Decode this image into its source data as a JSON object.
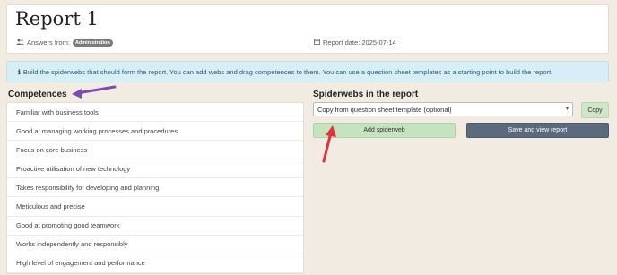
{
  "header": {
    "title": "Report 1",
    "answers_from_label": "Answers from:",
    "answers_from_badge": "Administration",
    "report_date_label": "Report date: 2025-07-14"
  },
  "info": {
    "text": "Build the spiderwebs that should form the report. You can add webs and drag competences to them. You can use a question sheet templates as a starting point to build the report."
  },
  "competences": {
    "title": "Competences",
    "items": [
      "Familiar with business tools",
      "Good at managing working processes and procedures",
      "Focus on core business",
      "Proactive utilisation of new technology",
      "Takes responsibility for developing and planning",
      "Meticulous and precise",
      "Good at promoting good teamwork",
      "Works independently and responsibly",
      "High level of engagement and performance"
    ]
  },
  "spiderwebs": {
    "title": "Spiderwebs in the report",
    "template_select_value": "Copy from question sheet template (optional)",
    "copy_label": "Copy",
    "add_label": "Add spiderweb",
    "save_label": "Save and view report"
  },
  "colors": {
    "annotation_arrow_purple": "#7a4bb0",
    "annotation_arrow_red": "#e0323a",
    "info_background": "#d8eef5",
    "add_button": "#c6e3c0",
    "save_button": "#5b6a7c"
  }
}
